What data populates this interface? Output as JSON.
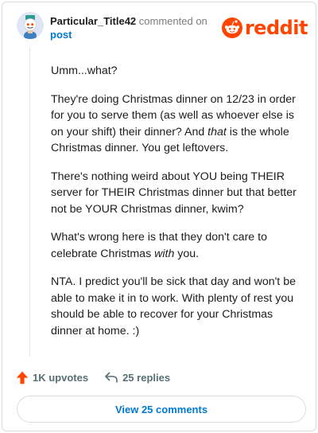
{
  "comment": {
    "username": "Particular_Title42",
    "action": "commented on",
    "post_link": "post",
    "brand": "reddit",
    "paragraphs": [
      [
        "Umm...what?"
      ],
      [
        "They're doing Christmas dinner on 12/23 in order for you to serve them (as well as whoever else is on your shift) their dinner? And ",
        "that",
        " is the whole Christmas dinner. You get leftovers."
      ],
      [
        "There's nothing weird about YOU being THEIR server for THEIR Christmas dinner but that better not be YOUR Christmas dinner, kwim?"
      ],
      [
        "What's wrong here is that they don't care to celebrate Christmas ",
        "with",
        " you."
      ],
      [
        "NTA. I predict you'll be sick that day and won't be able to make it in to work. With plenty of rest you should be able to recover for your Christmas dinner at home. :)"
      ]
    ]
  },
  "actions": {
    "upvotes": "1K upvotes",
    "replies": "25 replies",
    "view_comments": "View 25 comments"
  },
  "colors": {
    "accent": "#ff4500",
    "link": "#0079d3",
    "muted": "#7c7c7c"
  },
  "icons": {
    "upvote": "upvote-arrow-icon",
    "reply": "reply-arrow-icon",
    "avatar": "snoo-avatar",
    "logo": "reddit-snoo-logo"
  }
}
